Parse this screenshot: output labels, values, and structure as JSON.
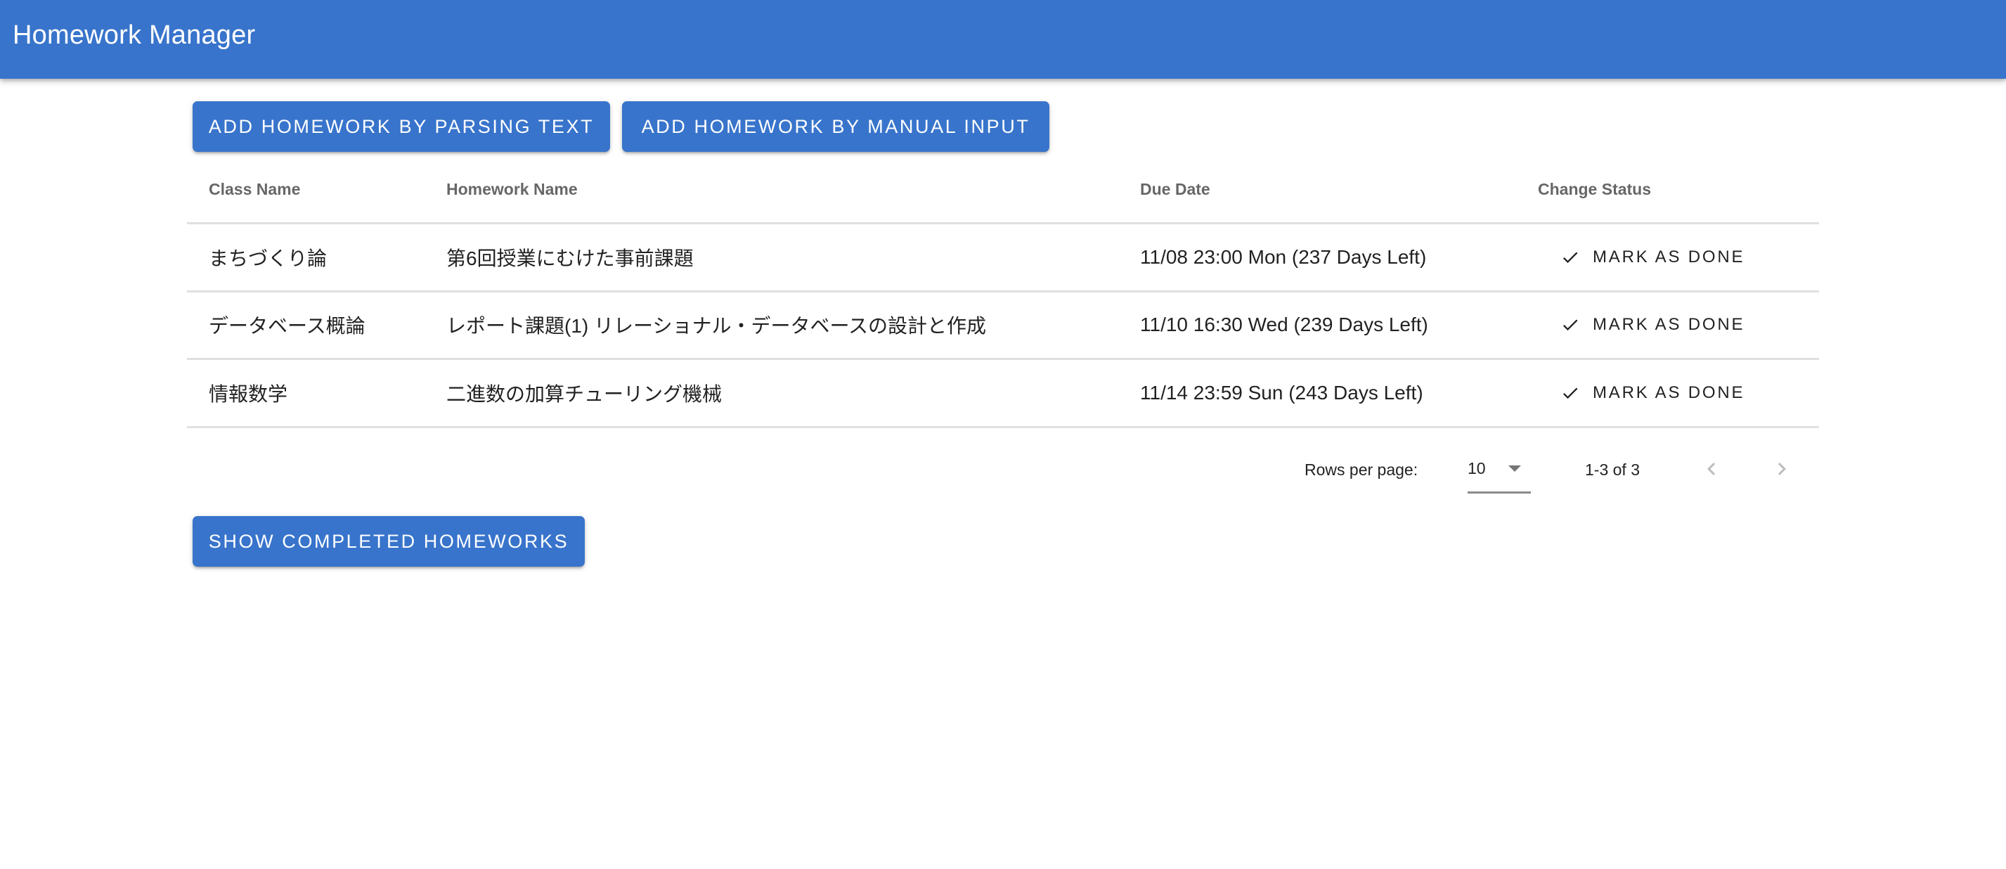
{
  "app": {
    "title": "Homework Manager",
    "accent_color": "#3874cb"
  },
  "actions": {
    "add_by_parsing_label": "Add Homework by Parsing Text",
    "add_by_manual_label": "Add Homework by Manual Input",
    "show_completed_label": "Show Completed Homeworks"
  },
  "table": {
    "columns": [
      "Class Name",
      "Homework Name",
      "Due Date",
      "Change Status"
    ],
    "rows": [
      {
        "class_name": "まちづくり論",
        "homework_name": "第6回授業にむけた事前課題",
        "due_date": "11/08 23:00 Mon (237 Days Left)",
        "action_label": "Mark as Done",
        "action_icon": "check-icon"
      },
      {
        "class_name": "データベース概論",
        "homework_name": "レポート課題(1) リレーショナル・データベースの設計と作成",
        "due_date": "11/10 16:30 Wed (239 Days Left)",
        "action_label": "Mark as Done",
        "action_icon": "check-icon"
      },
      {
        "class_name": "情報数学",
        "homework_name": "二進数の加算チューリング機械",
        "due_date": "11/14 23:59 Sun (243 Days Left)",
        "action_label": "Mark as Done",
        "action_icon": "check-icon"
      }
    ]
  },
  "pagination": {
    "rows_per_page_label": "Rows per page:",
    "rows_per_page_value": "10",
    "range_text": "1-3 of 3",
    "prev_icon": "chevron-left-icon",
    "next_icon": "chevron-right-icon",
    "prev_disabled": true,
    "next_disabled": true
  }
}
